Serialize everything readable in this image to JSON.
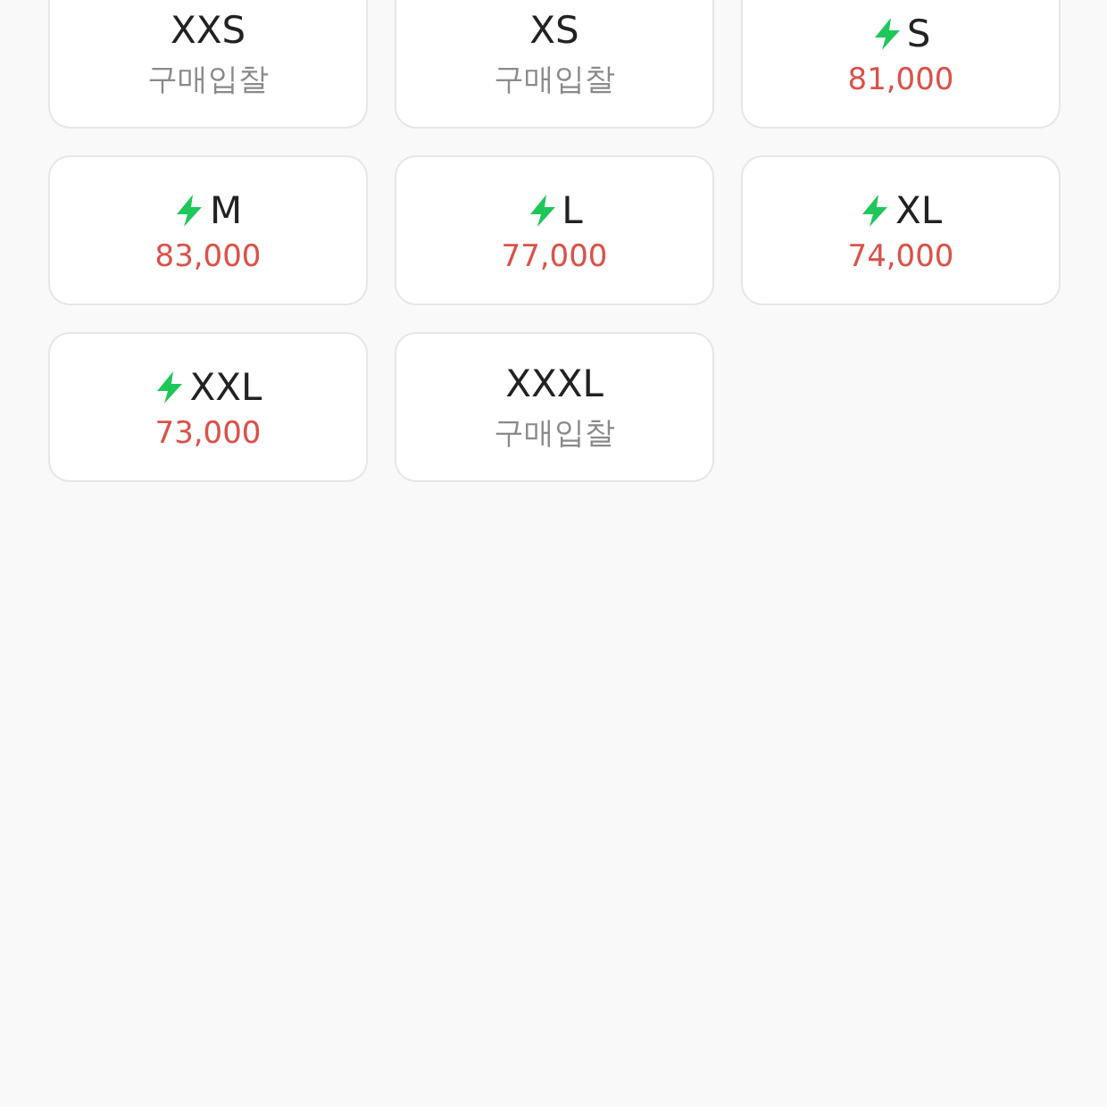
{
  "sizes": [
    {
      "size": "XXS",
      "express": false,
      "kind": "bid",
      "sub": "구매입찰"
    },
    {
      "size": "XS",
      "express": false,
      "kind": "bid",
      "sub": "구매입찰"
    },
    {
      "size": "S",
      "express": true,
      "kind": "price",
      "sub": "81,000"
    },
    {
      "size": "M",
      "express": true,
      "kind": "price",
      "sub": "83,000"
    },
    {
      "size": "L",
      "express": true,
      "kind": "price",
      "sub": "77,000"
    },
    {
      "size": "XL",
      "express": true,
      "kind": "price",
      "sub": "74,000"
    },
    {
      "size": "XXL",
      "express": true,
      "kind": "price",
      "sub": "73,000"
    },
    {
      "size": "XXXL",
      "express": false,
      "kind": "bid",
      "sub": "구매입찰"
    }
  ]
}
